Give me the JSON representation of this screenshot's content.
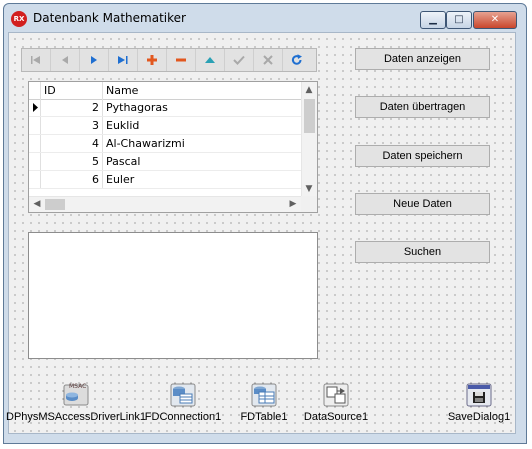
{
  "window": {
    "title": "Datenbank Mathematiker",
    "app_icon_text": "RX"
  },
  "controls": {
    "minimize": "▁",
    "maximize": "□",
    "close": "✕"
  },
  "navigator": {
    "buttons": [
      {
        "name": "first-record-button",
        "icon": "first-icon"
      },
      {
        "name": "prior-record-button",
        "icon": "prior-icon"
      },
      {
        "name": "next-record-button",
        "icon": "next-icon"
      },
      {
        "name": "last-record-button",
        "icon": "last-icon"
      },
      {
        "name": "insert-record-button",
        "icon": "plus-icon"
      },
      {
        "name": "delete-record-button",
        "icon": "minus-icon"
      },
      {
        "name": "edit-record-button",
        "icon": "up-triangle-icon"
      },
      {
        "name": "post-record-button",
        "icon": "check-icon"
      },
      {
        "name": "cancel-record-button",
        "icon": "x-icon"
      },
      {
        "name": "refresh-record-button",
        "icon": "refresh-icon"
      }
    ]
  },
  "grid": {
    "columns": [
      "ID",
      "Name"
    ],
    "rows": [
      {
        "id": "2",
        "name": "Pythagoras"
      },
      {
        "id": "3",
        "name": "Euklid"
      },
      {
        "id": "4",
        "name": "Al-Chawarizmi"
      },
      {
        "id": "5",
        "name": "Pascal"
      },
      {
        "id": "6",
        "name": "Euler"
      }
    ]
  },
  "buttons": {
    "show": "Daten anzeigen",
    "transfer": "Daten übertragen",
    "save": "Daten speichern",
    "new": "Neue Daten",
    "search": "Suchen"
  },
  "components": {
    "driver_link": "DPhysMSAccessDriverLink1",
    "driver_icon_text": "MSAC",
    "connection": "FDConnection1",
    "table": "FDTable1",
    "datasource": "DataSource1",
    "savedialog": "SaveDialog1"
  },
  "colors": {
    "accent": "#1f6fd1",
    "insert": "#e2571e",
    "close": "#c9462c",
    "edit": "#2aa1b5"
  }
}
